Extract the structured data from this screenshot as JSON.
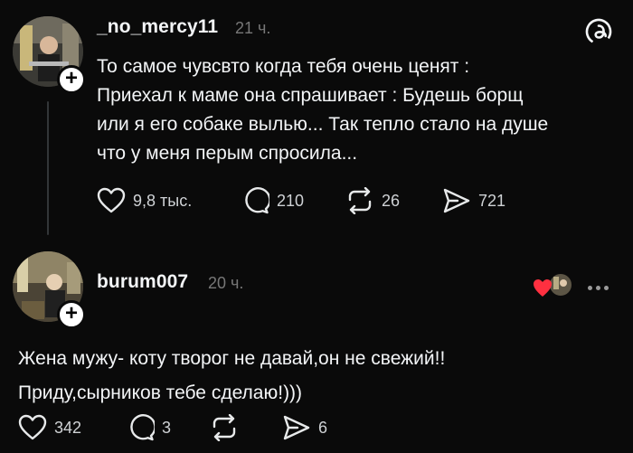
{
  "posts": [
    {
      "username": "_no_mercy11",
      "time": "21 ч.",
      "text": "То самое чувсвто когда тебя очень ценят :\nПриехал к маме она спрашивает : Будешь борщ\nили я его собаке вылью... Так тепло стало на душе\nчто у меня перым спросила...",
      "likes": "9,8 тыс.",
      "replies": "210",
      "reposts": "26",
      "shares": "721"
    },
    {
      "username": "burum007",
      "time": "20 ч.",
      "text": "Жена мужу- коту творог не давай,он не свежий!!\nПриду,сырников тебе сделаю!)))",
      "likes": "342",
      "replies": "3",
      "reposts": "",
      "shares": "6"
    }
  ],
  "icons": {
    "like": "heart-icon",
    "reply": "comment-bubble-icon",
    "repost": "repost-arrows-icon",
    "share": "send-paper-plane-icon",
    "logo": "threads-logo-icon",
    "more": "more-options-icon"
  },
  "colors": {
    "background": "#0a0a0a",
    "text": "#f3f5f7",
    "muted": "#777777",
    "like_red": "#ff3040"
  }
}
